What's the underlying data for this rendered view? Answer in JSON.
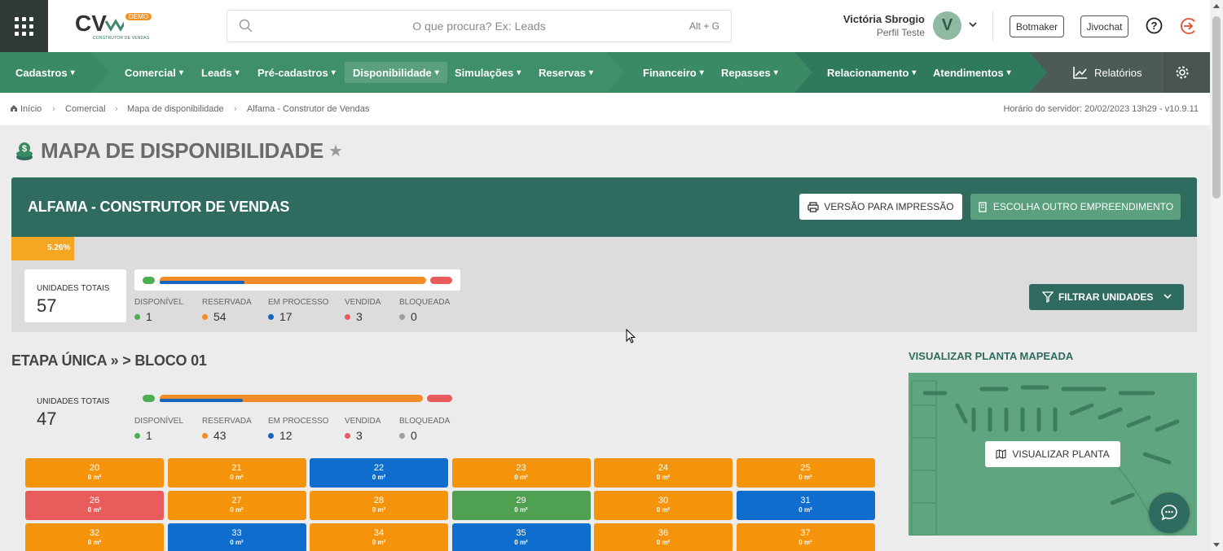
{
  "header": {
    "logo_text": "CV",
    "logo_demo": "DEMO",
    "logo_sub": "CONSTRUTOR DE VENDAS",
    "search_placeholder": "O que procura? Ex: Leads",
    "search_shortcut": "Alt + G",
    "user_name": "Victória Sbrogio",
    "user_profile": "Perfil Teste",
    "avatar_letter": "V",
    "botmaker": "Botmaker",
    "jivochat": "Jivochat"
  },
  "nav": {
    "cadastros": "Cadastros",
    "comercial": "Comercial",
    "leads": "Leads",
    "pre_cadastros": "Pré-cadastros",
    "disponibilidade": "Disponibilidade",
    "simulacoes": "Simulações",
    "reservas": "Reservas",
    "financeiro": "Financeiro",
    "repasses": "Repasses",
    "relacionamento": "Relacionamento",
    "atendimentos": "Atendimentos",
    "relatorios": "Relatórios"
  },
  "breadcrumb": {
    "items": [
      "Início",
      "Comercial",
      "Mapa de disponibilidade",
      "Alfama - Construtor de Vendas"
    ],
    "server_time": "Horário do servidor: 20/02/2023 13h29 - v10.9.11"
  },
  "page": {
    "title": "MAPA DE DISPONIBILIDADE",
    "project": "ALFAMA - CONSTRUTOR DE VENDAS",
    "print_button": "VERSÃO PARA IMPRESSÃO",
    "choose_button": "ESCOLHA OUTRO EMPREENDIMENTO",
    "progress_label": "5.26%",
    "progress_value": 0.0526,
    "filter_button": "FILTRAR UNIDADES",
    "block_title": "ETAPA ÚNICA » > BLOCO 01",
    "map_title": "VISUALIZAR PLANTA MAPEADA",
    "map_button": "VISUALIZAR PLANTA"
  },
  "totals": {
    "label": "UNIDADES TOTAIS",
    "value": "57",
    "stats": [
      {
        "label": "DISPONÍVEL",
        "value": "1",
        "color": "#4caf50"
      },
      {
        "label": "RESERVADA",
        "value": "54",
        "color": "#f28c28"
      },
      {
        "label": "EM PROCESSO",
        "value": "17",
        "color": "#1565c0"
      },
      {
        "label": "VENDIDA",
        "value": "3",
        "color": "#e85c5c"
      },
      {
        "label": "BLOQUEADA",
        "value": "0",
        "color": "#9e9e9e"
      }
    ]
  },
  "block_totals": {
    "label": "UNIDADES TOTAIS",
    "value": "47",
    "stats": [
      {
        "label": "DISPONÍVEL",
        "value": "1",
        "color": "#4caf50"
      },
      {
        "label": "RESERVADA",
        "value": "43",
        "color": "#f28c28"
      },
      {
        "label": "EM PROCESSO",
        "value": "12",
        "color": "#1565c0"
      },
      {
        "label": "VENDIDA",
        "value": "3",
        "color": "#e85c5c"
      },
      {
        "label": "BLOQUEADA",
        "value": "0",
        "color": "#9e9e9e"
      }
    ]
  },
  "units": [
    {
      "n": "20",
      "a": "0 m²",
      "s": "reservada"
    },
    {
      "n": "21",
      "a": "0 m²",
      "s": "reservada"
    },
    {
      "n": "22",
      "a": "0 m²",
      "s": "processo"
    },
    {
      "n": "23",
      "a": "0 m²",
      "s": "reservada"
    },
    {
      "n": "24",
      "a": "0 m²",
      "s": "reservada"
    },
    {
      "n": "25",
      "a": "0 m²",
      "s": "reservada"
    },
    {
      "n": "26",
      "a": "0 m²",
      "s": "vendida"
    },
    {
      "n": "27",
      "a": "0 m²",
      "s": "reservada"
    },
    {
      "n": "28",
      "a": "0 m²",
      "s": "reservada"
    },
    {
      "n": "29",
      "a": "0 m²",
      "s": "disponivel"
    },
    {
      "n": "30",
      "a": "0 m²",
      "s": "reservada"
    },
    {
      "n": "31",
      "a": "0 m²",
      "s": "processo"
    },
    {
      "n": "32",
      "a": "0 m²",
      "s": "reservada"
    },
    {
      "n": "33",
      "a": "0 m²",
      "s": "processo"
    },
    {
      "n": "34",
      "a": "0 m²",
      "s": "reservada"
    },
    {
      "n": "35",
      "a": "0 m²",
      "s": "processo"
    },
    {
      "n": "36",
      "a": "0 m²",
      "s": "reservada"
    },
    {
      "n": "37",
      "a": "0 m²",
      "s": "reservada"
    }
  ],
  "status_colors": {
    "reservada": "#f5940a",
    "processo": "#0f6ecd",
    "vendida": "#e85c5c",
    "disponivel": "#50a051"
  }
}
